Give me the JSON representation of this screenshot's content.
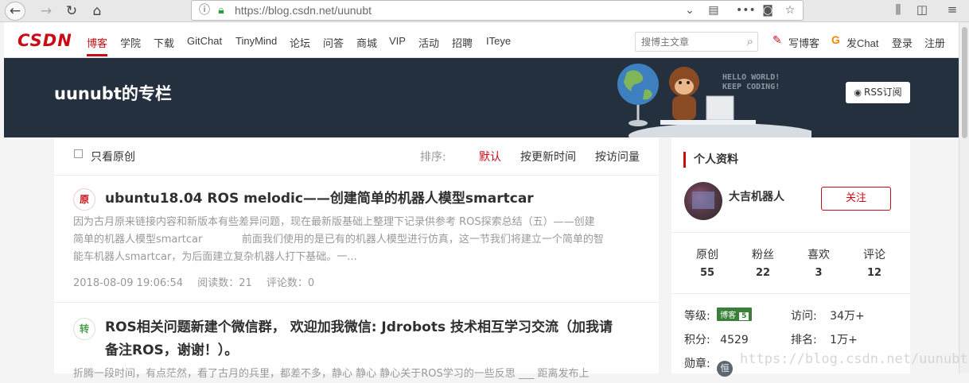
{
  "browser": {
    "url_host": "https://blog.csdn.net/uunubt",
    "back_icon": "back-arrow-icon",
    "forward_icon": "forward-arrow-icon",
    "reload_icon": "reload-icon",
    "home_icon": "home-icon"
  },
  "nav": {
    "logo": "CSDN",
    "items": [
      "博客",
      "学院",
      "下载",
      "GitChat",
      "TinyMind",
      "论坛",
      "问答",
      "商城",
      "VIP",
      "活动",
      "招聘",
      "ITeye"
    ],
    "search_placeholder": "搜博主文章",
    "write_blog": "写博客",
    "fachat": "发Chat",
    "login": "登录",
    "register": "注册"
  },
  "banner": {
    "title": "uunubt的专栏",
    "hello": "HELLO WORLD!",
    "keep": "KEEP CODING!",
    "rss": "RSS订阅"
  },
  "filter": {
    "only_original": "只看原创",
    "sort_label": "排序:",
    "sort_default": "默认",
    "sort_update": "按更新时间",
    "sort_visits": "按访问量"
  },
  "articles": [
    {
      "type": "原",
      "title": "ubuntu18.04 ROS melodic——创建简单的机器人模型smartcar",
      "desc_line1": "因为古月原来链接内容和新版本有些差异问题，现在最新版基础上整理下记录供参考 ROS探索总结（五）——创建",
      "desc_line2": "简单的机器人模型smartcar            前面我们使用的是已有的机器人模型进行仿真，这一节我们将建立一个简单的智",
      "desc_line3": "能车机器人smartcar，为后面建立复杂机器人打下基础。一...",
      "date": "2018-08-09 19:06:54",
      "reads": "阅读数：21",
      "comments": "评论数：0"
    },
    {
      "type": "转",
      "title_line1": "ROS相关问题新建个微信群， 欢迎加我微信: Jdrobots 技术相互学习交流（加我请",
      "title_line2": "备注ROS，谢谢！）。",
      "desc_line1": "折腾一段时间，有点茫然，看了古月的兵里，都差不多，静心 静心 静心关于ROS学习的一些反思 ___ 距离发布上"
    }
  ],
  "profile": {
    "heading": "个人资料",
    "name": "大吉机器人",
    "follow": "关注",
    "stats": [
      {
        "label": "原创",
        "value": "55"
      },
      {
        "label": "粉丝",
        "value": "22"
      },
      {
        "label": "喜欢",
        "value": "3"
      },
      {
        "label": "评论",
        "value": "12"
      }
    ],
    "level_label": "等级:",
    "level_badge": "博客",
    "level_num": "5",
    "visits_label": "访问:",
    "visits_value": "34万+",
    "points_label": "积分:",
    "points_value": "4529",
    "rank_label": "排名:",
    "rank_value": "1万+",
    "medal_label": "勋章:",
    "medal_glyph": "恒"
  },
  "watermark": "https://blog.csdn.net/uunubt",
  "colors": {
    "accent": "#ca0c16",
    "banner_bg": "#25303e"
  }
}
